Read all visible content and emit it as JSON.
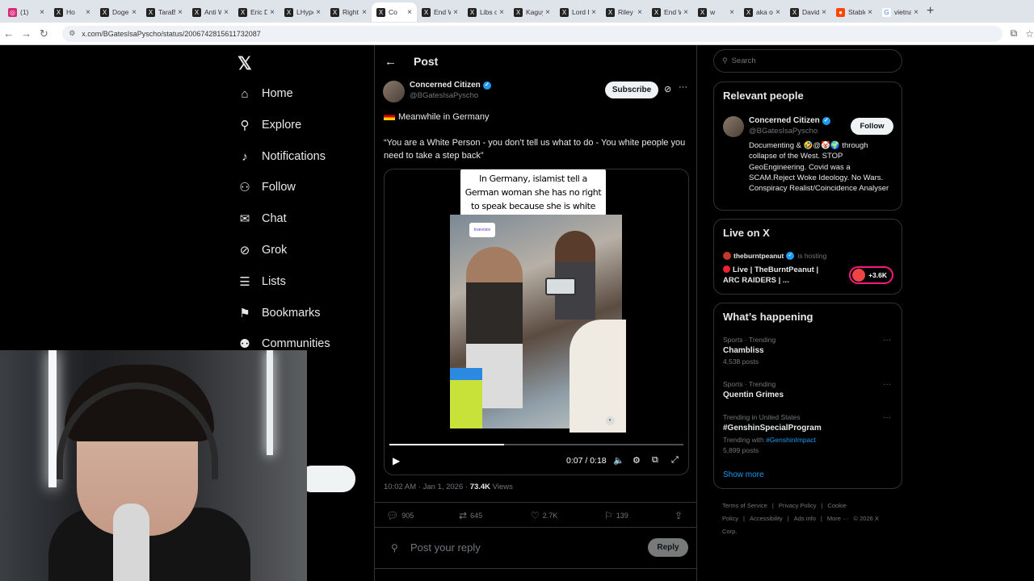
{
  "browser": {
    "tabs": [
      {
        "label": "(1)",
        "icon": "instagram-icon",
        "active": false
      },
      {
        "label": "Ho",
        "icon": "x-icon",
        "active": false
      },
      {
        "label": "DogeDe",
        "icon": "x-icon",
        "active": false
      },
      {
        "label": "TaraBu",
        "icon": "x-icon",
        "active": false
      },
      {
        "label": "Anti W",
        "icon": "x-icon",
        "active": false
      },
      {
        "label": "Eric Da",
        "icon": "x-icon",
        "active": false
      },
      {
        "label": "LHypo",
        "icon": "x-icon",
        "active": false
      },
      {
        "label": "Right A",
        "icon": "x-icon",
        "active": false
      },
      {
        "label": "Co",
        "icon": "x-icon",
        "active": true
      },
      {
        "label": "End W",
        "icon": "x-icon",
        "active": false
      },
      {
        "label": "Libs of",
        "icon": "x-icon",
        "active": false
      },
      {
        "label": "Kaguya",
        "icon": "x-icon",
        "active": false
      },
      {
        "label": "Lord Be",
        "icon": "x-icon",
        "active": false
      },
      {
        "label": "Riley G",
        "icon": "x-icon",
        "active": false
      },
      {
        "label": "End W",
        "icon": "x-icon",
        "active": false
      },
      {
        "label": "w",
        "icon": "x-icon",
        "active": false
      },
      {
        "label": "aka on",
        "icon": "x-icon",
        "active": false
      },
      {
        "label": "David S",
        "icon": "x-icon",
        "active": false
      },
      {
        "label": "Stable F",
        "icon": "reddit-icon",
        "active": false
      },
      {
        "label": "vietnam",
        "icon": "google-icon",
        "active": false
      }
    ],
    "new_tab_label": "+",
    "url": "x.com/BGatesIsaPyscho/status/2006742815611732087"
  },
  "sidebar": {
    "logo": "𝕏",
    "items": [
      {
        "label": "Home",
        "icon": "home-icon",
        "glyph": "⌂"
      },
      {
        "label": "Explore",
        "icon": "search-icon",
        "glyph": "⚲"
      },
      {
        "label": "Notifications",
        "icon": "bell-icon",
        "glyph": "♪"
      },
      {
        "label": "Follow",
        "icon": "add-user-icon",
        "glyph": "⚇"
      },
      {
        "label": "Chat",
        "icon": "mail-icon",
        "glyph": "✉"
      },
      {
        "label": "Grok",
        "icon": "grok-icon",
        "glyph": "⊘"
      },
      {
        "label": "Lists",
        "icon": "list-icon",
        "glyph": "☰"
      },
      {
        "label": "Bookmarks",
        "icon": "bookmark-icon",
        "glyph": "⚑"
      },
      {
        "label": "Communities",
        "icon": "communities-icon",
        "glyph": "⚉"
      }
    ]
  },
  "main": {
    "header_title": "Post",
    "author_name": "Concerned Citizen",
    "author_handle": "@BGatesIsaPyscho",
    "subscribe_label": "Subscribe",
    "text_line1": "Meanwhile in Germany",
    "text_line2": "“You are a White Person - you don’t tell us what to do - You white people you need to take a step back”",
    "video_caption": "In Germany, islamist  tell a German woman she has no right to speak because she is white",
    "video_watermark": "truevoice",
    "video_time": "0:07 / 0:18",
    "video_progress": 0.39,
    "timestamp": "10:02 AM · Jan 1, 2026 · ",
    "views_count": "73.4K",
    "views_label": " Views",
    "replies": "905",
    "reposts": "645",
    "likes": "2.7K",
    "bookmarks": "139",
    "reply_placeholder": "Post your reply",
    "reply_button": "Reply"
  },
  "right": {
    "search_placeholder": "Search",
    "relevant_title": "Relevant people",
    "rp_name": "Concerned Citizen",
    "rp_handle": "@BGatesIsaPyscho",
    "follow_label": "Follow",
    "rp_bio": "Documenting & 🤣@🤡🌍 through collapse of the West. STOP GeoEngineering. Covid was a SCAM.Reject Woke Ideology. No Wars. Conspiracy Realist/Coincidence Analyser",
    "live_title": "Live on X",
    "live_host": "theburntpeanut",
    "live_hosting": "is hosting",
    "live_stream_title": "Live | TheBurntPeanut | ARC RAIDERS | ...",
    "live_listeners": "+3.6K",
    "happening_title": "What’s happening",
    "trends": [
      {
        "category": "Sports · Trending",
        "title": "Chambliss",
        "count": "4,538 posts",
        "with": ""
      },
      {
        "category": "Sports · Trending",
        "title": "Quentin Grimes",
        "count": "",
        "with": ""
      },
      {
        "category": "Trending in United States",
        "title": "#GenshinSpecialProgram",
        "count": "5,899 posts",
        "with": "#GenshinImpact"
      }
    ],
    "trending_with_label": "Trending with ",
    "show_more": "Show more",
    "footer": [
      "Terms of Service",
      "|",
      "Privacy Policy",
      "|",
      "Cookie Policy",
      "|",
      "Accessibility",
      "|",
      "Ads info",
      "|",
      "More ···",
      "© 2026 X Corp."
    ]
  }
}
